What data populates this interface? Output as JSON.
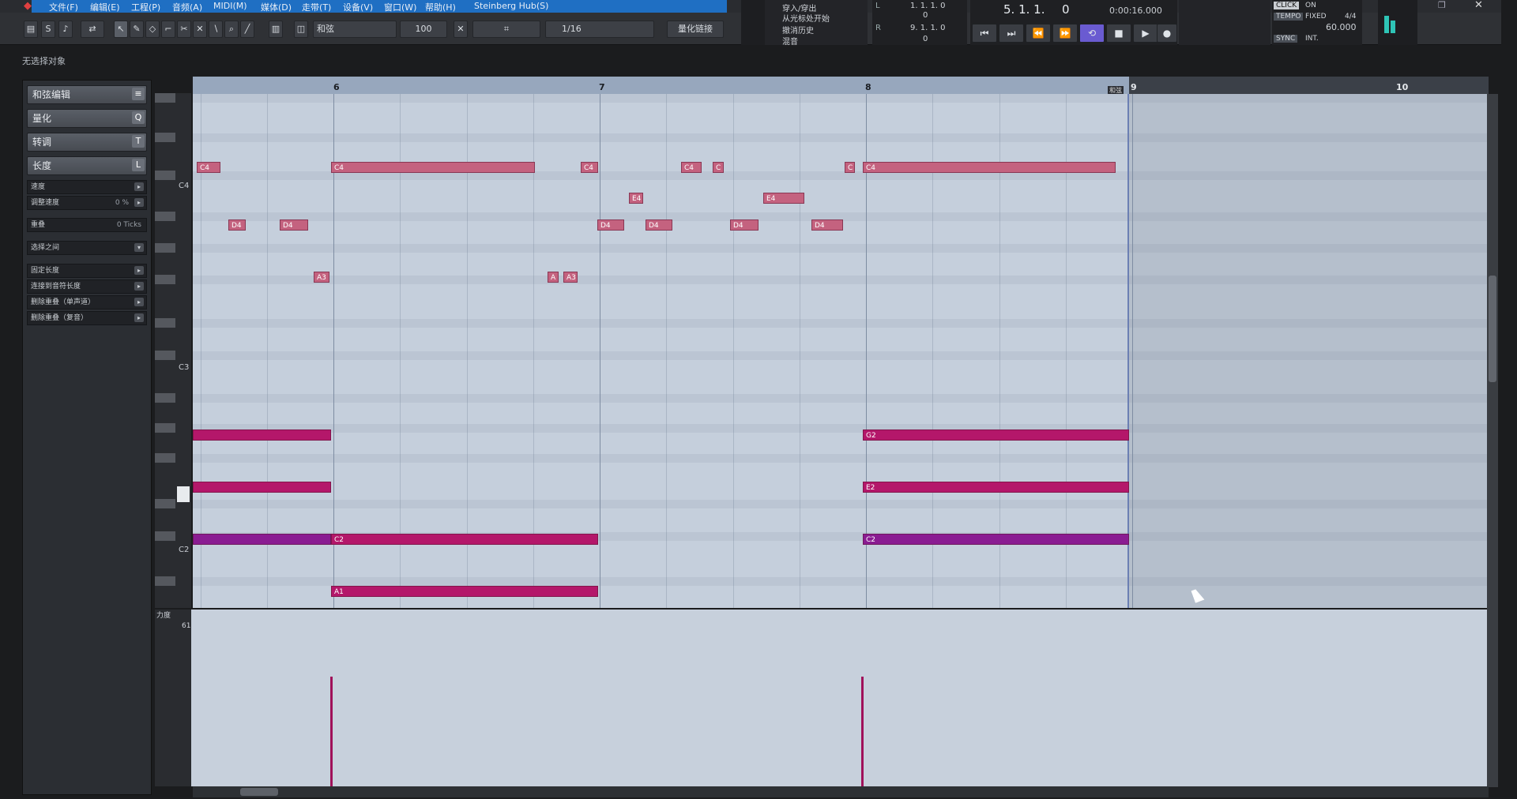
{
  "menubar": {
    "logo_icon": "cubase-logo-icon",
    "items": [
      "文件(F)",
      "编辑(E)",
      "工程(P)",
      "音频(A)",
      "MIDI(M)",
      "媒体(D)",
      "走带(T)",
      "设备(V)",
      "窗口(W)",
      "帮助(H)",
      "Steinberg Hub(S)"
    ]
  },
  "toolbar": {
    "velocity_value": "100",
    "chord_label": "和弦",
    "quantize_value": "1/16",
    "quantize_link_label": "量化链接",
    "history_items": [
      "穿入/穿出",
      "从光标处开始",
      "撤消历史",
      "混音"
    ],
    "locator_left": "1. 1. 1.    0",
    "locator_right": "9. 1. 1.    0",
    "small_values": [
      "0",
      "0"
    ],
    "position_bars": "5. 1. 1.",
    "position_ticks": "0",
    "time_display": "0:00:16.000",
    "click_label": "CLICK",
    "click_state": "ON",
    "tempo_label": "TEMPO",
    "tempo_mode": "FIXED",
    "signature": "4/4",
    "tempo_value": "60.000",
    "sync_label": "SYNC",
    "sync_mode": "INT."
  },
  "status": {
    "no_selection": "无选择对象"
  },
  "inspector": {
    "sections": [
      {
        "label": "和弦编辑",
        "icon": "≡"
      },
      {
        "label": "量化",
        "icon": "Q"
      },
      {
        "label": "转调",
        "icon": "T"
      },
      {
        "label": "长度",
        "icon": "L"
      }
    ],
    "rows": [
      {
        "label": "速度",
        "value": ""
      },
      {
        "label": "调整速度",
        "value": "0 %"
      },
      {
        "label": "重叠",
        "value": "0 Ticks"
      },
      {
        "label": "选择之间",
        "value": ""
      },
      {
        "label": "固定长度",
        "value": ""
      },
      {
        "label": "连接到音符长度",
        "value": ""
      },
      {
        "label": "删除重叠（单声道）",
        "value": ""
      },
      {
        "label": "删除重叠（复音）",
        "value": ""
      }
    ]
  },
  "keyboard": {
    "labels": [
      "C4",
      "C3",
      "C2"
    ]
  },
  "ruler": {
    "bars": [
      "6",
      "7",
      "8",
      "9",
      "10"
    ],
    "chord_track_tag": "和弦"
  },
  "notes": [
    {
      "pitch": "C4",
      "label": "C4",
      "color": "pink"
    },
    {
      "pitch": "D4",
      "label": "D4",
      "color": "pink"
    },
    {
      "pitch": "D4",
      "label": "D4",
      "color": "pink"
    },
    {
      "pitch": "A3",
      "label": "A3",
      "color": "pink"
    },
    {
      "pitch": "C4",
      "label": "C4",
      "color": "pink"
    },
    {
      "pitch": "A3",
      "label": "A",
      "color": "pink"
    },
    {
      "pitch": "A3",
      "label": "A3",
      "color": "pink"
    },
    {
      "pitch": "C4",
      "label": "C4",
      "color": "pink"
    },
    {
      "pitch": "D4",
      "label": "D4",
      "color": "pink"
    },
    {
      "pitch": "E4",
      "label": "E4",
      "color": "pink"
    },
    {
      "pitch": "D4",
      "label": "D4",
      "color": "pink"
    },
    {
      "pitch": "C4",
      "label": "C4",
      "color": "pink"
    },
    {
      "pitch": "C4",
      "label": "C",
      "color": "pink"
    },
    {
      "pitch": "D4",
      "label": "D4",
      "color": "pink"
    },
    {
      "pitch": "E4",
      "label": "E4",
      "color": "pink"
    },
    {
      "pitch": "D4",
      "label": "D4",
      "color": "pink"
    },
    {
      "pitch": "C4",
      "label": "C",
      "color": "pink"
    },
    {
      "pitch": "C4",
      "label": "C4",
      "color": "pink"
    },
    {
      "pitch": "G2",
      "label": "",
      "color": "magenta"
    },
    {
      "pitch": "E2",
      "label": "",
      "color": "magenta"
    },
    {
      "pitch": "C2",
      "label": "",
      "color": "purple"
    },
    {
      "pitch": "C2",
      "label": "C2",
      "color": "magenta"
    },
    {
      "pitch": "A1",
      "label": "A1",
      "color": "magenta"
    },
    {
      "pitch": "G2",
      "label": "G2",
      "color": "magenta"
    },
    {
      "pitch": "E2",
      "label": "E2",
      "color": "magenta"
    },
    {
      "pitch": "C2",
      "label": "C2",
      "color": "purple"
    }
  ],
  "velocity_lane": {
    "label": "力度",
    "tick": "61"
  },
  "colors": {
    "note_pink": "#c4627f",
    "note_magenta": "#b4176a",
    "note_purple": "#8a1c92",
    "menubar_blue": "#1f6fc3"
  }
}
